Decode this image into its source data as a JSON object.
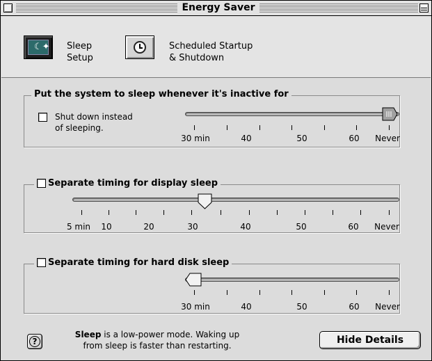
{
  "window": {
    "title": "Energy Saver"
  },
  "toolbar": {
    "sleep_setup": {
      "line1": "Sleep",
      "line2": "Setup",
      "icon": "sleep-moon-icon"
    },
    "scheduled": {
      "line1": "Scheduled Startup",
      "line2": "& Shutdown",
      "icon": "clock-icon"
    }
  },
  "system_sleep": {
    "title": "Put the system to sleep whenever it's inactive for",
    "shutdown_label_line1": "Shut down instead",
    "shutdown_label_line2": "of sleeping.",
    "shutdown_checked": false,
    "tick_labels": [
      "30 min",
      "40",
      "50",
      "60",
      "Never"
    ],
    "value": "Never"
  },
  "display_sleep": {
    "title": "Separate timing for display sleep",
    "checked": false,
    "tick_labels": [
      "5 min",
      "10",
      "20",
      "30",
      "40",
      "50",
      "60",
      "Never"
    ],
    "value_minutes": 32
  },
  "disk_sleep": {
    "title": "Separate timing for hard disk sleep",
    "checked": false,
    "tick_labels": [
      "30 min",
      "40",
      "50",
      "60",
      "Never"
    ],
    "value": "30 min"
  },
  "footer": {
    "help_label": "?",
    "help_bold": "Sleep",
    "help_rest_line1": " is a low-power mode. Waking up",
    "help_line2": "from sleep is faster than restarting.",
    "hide_details": "Hide Details"
  }
}
